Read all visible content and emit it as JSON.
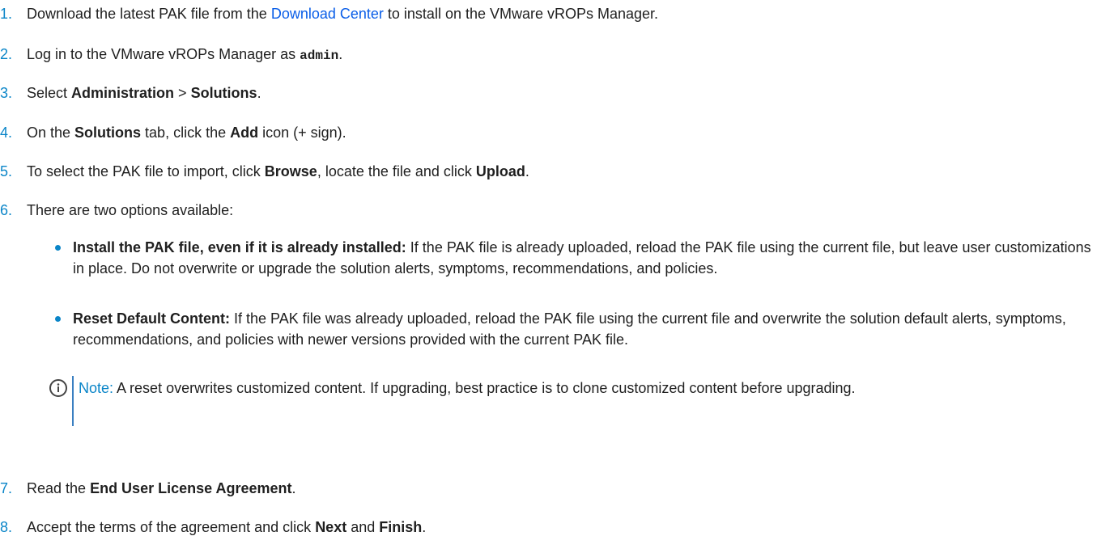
{
  "steps": [
    {
      "num": "1.",
      "pre": "Download the latest PAK file from the ",
      "link": "Download Center",
      "post": " to install on the VMware vROPs Manager."
    },
    {
      "num": "2.",
      "pre": "Log in to the VMware vROPs Manager as ",
      "code": "admin",
      "post": "."
    },
    {
      "num": "3.",
      "pre": "Select ",
      "b1": "Administration",
      "mid": " > ",
      "b2": "Solutions",
      "post": "."
    },
    {
      "num": "4.",
      "pre": "On the ",
      "b1": "Solutions",
      "mid": " tab, click the ",
      "b2": "Add",
      "post": " icon (+ sign)."
    },
    {
      "num": "5.",
      "pre": "To select the PAK file to import, click ",
      "b1": "Browse",
      "mid": ", locate the file and click ",
      "b2": "Upload",
      "post": "."
    },
    {
      "num": "6.",
      "text": "There are two options available:"
    },
    {
      "num": "7.",
      "pre": "Read the ",
      "b1": "End User License Agreement",
      "post": "."
    },
    {
      "num": "8.",
      "pre": "Accept the terms of the agreement and click ",
      "b1": "Next",
      "mid": " and ",
      "b2": "Finish",
      "post": "."
    }
  ],
  "options": [
    {
      "bold": "Install the PAK file, even if it is already installed:",
      "text": " If the PAK file is already uploaded, reload the PAK file using the current file, but leave user customizations in place. Do not overwrite or upgrade the solution alerts, symptoms, recommendations, and policies."
    },
    {
      "bold": "Reset Default Content:",
      "text": " If the PAK file was already uploaded, reload the PAK file using the current file and overwrite the solution default alerts, symptoms, recommendations, and policies with newer versions provided with the current PAK file."
    }
  ],
  "note": {
    "label": "Note:",
    "text": " A reset overwrites customized content. If upgrading, best practice is to clone customized content before upgrading."
  },
  "colors": {
    "accent": "#0a85c8",
    "link": "#0a5ee8",
    "note_bar": "#3a7fc1"
  }
}
